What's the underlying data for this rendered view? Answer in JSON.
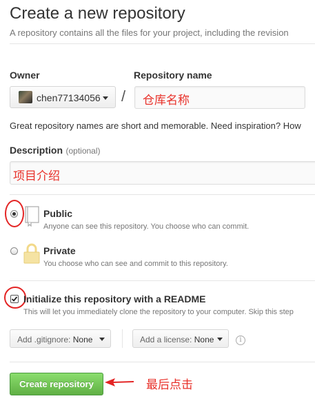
{
  "header": {
    "title": "Create a new repository",
    "subtitle": "A repository contains all the files for your project, including the revision"
  },
  "owner": {
    "label": "Owner",
    "value": "chen77134056"
  },
  "separator": "/",
  "repo_name": {
    "label": "Repository name",
    "value": "仓库名称"
  },
  "hint": "Great repository names are short and memorable. Need inspiration? How",
  "description": {
    "label": "Description",
    "optional": "(optional)",
    "value": "项目介绍"
  },
  "visibility": {
    "public_title": "Public",
    "public_desc": "Anyone can see this repository. You choose who can commit.",
    "private_title": "Private",
    "private_desc": "You choose who can see and commit to this repository.",
    "selected": "Public"
  },
  "readme": {
    "title": "Initialize this repository with a README",
    "desc": "This will let you immediately clone the repository to your computer. Skip this step",
    "checked": true
  },
  "gitignore": {
    "label": "Add .gitignore:",
    "value": "None"
  },
  "license": {
    "label": "Add a license:",
    "value": "None"
  },
  "info_glyph": "i",
  "submit": {
    "label": "Create repository"
  },
  "annotation": {
    "text": "最后点击",
    "color": "#e8312a"
  },
  "colors": {
    "submit_green": "#60b044",
    "annotation_red": "#e32424"
  },
  "icons": [
    "book-icon",
    "lock-icon",
    "info-icon",
    "chevron-down-icon",
    "arrow-icon"
  ]
}
